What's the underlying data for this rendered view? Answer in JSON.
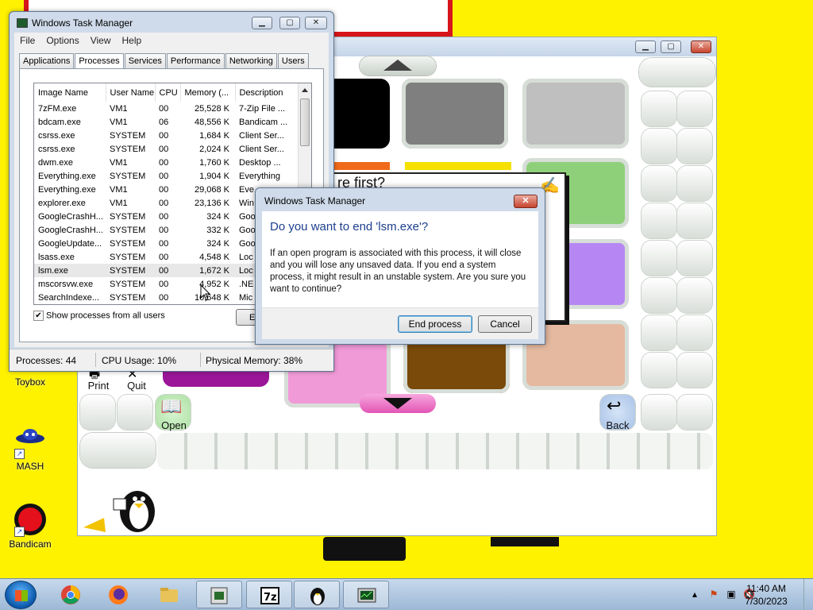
{
  "desktop": {
    "icons": [
      {
        "label": "Toybox",
        "icon": "toybox-icon"
      },
      {
        "label": "MASH",
        "icon": "mash-icon"
      },
      {
        "label": "Bandicam",
        "icon": "bandicam-icon"
      }
    ]
  },
  "tuxpaint": {
    "tools": {
      "print": "Print",
      "quit": "Quit",
      "open": "Open",
      "back": "Back"
    },
    "question_text": "re first?",
    "swatch_colors": [
      "#000000",
      "#7f7f7f",
      "#bfbfbf",
      "#8ed07a",
      "#b687f2",
      "#9a1597",
      "#f19ad8",
      "#7a4a0a",
      "#e5b9a0",
      "#f06a1b",
      "#f6e000"
    ]
  },
  "task_manager": {
    "title": "Windows Task Manager",
    "menu": [
      "File",
      "Options",
      "View",
      "Help"
    ],
    "tabs": [
      "Applications",
      "Processes",
      "Services",
      "Performance",
      "Networking",
      "Users"
    ],
    "active_tab": "Processes",
    "columns": [
      "Image Name",
      "User Name",
      "CPU",
      "Memory (...",
      "Description"
    ],
    "processes": [
      {
        "image": "7zFM.exe",
        "user": "VM1",
        "cpu": "00",
        "memory": "25,528 K",
        "desc": "7-Zip File ..."
      },
      {
        "image": "bdcam.exe",
        "user": "VM1",
        "cpu": "06",
        "memory": "48,556 K",
        "desc": "Bandicam ..."
      },
      {
        "image": "csrss.exe",
        "user": "SYSTEM",
        "cpu": "00",
        "memory": "1,684 K",
        "desc": "Client Ser..."
      },
      {
        "image": "csrss.exe",
        "user": "SYSTEM",
        "cpu": "00",
        "memory": "2,024 K",
        "desc": "Client Ser..."
      },
      {
        "image": "dwm.exe",
        "user": "VM1",
        "cpu": "00",
        "memory": "1,760 K",
        "desc": "Desktop ..."
      },
      {
        "image": "Everything.exe",
        "user": "SYSTEM",
        "cpu": "00",
        "memory": "1,904 K",
        "desc": "Everything"
      },
      {
        "image": "Everything.exe",
        "user": "VM1",
        "cpu": "00",
        "memory": "29,068 K",
        "desc": "Eve"
      },
      {
        "image": "explorer.exe",
        "user": "VM1",
        "cpu": "00",
        "memory": "23,136 K",
        "desc": "Win"
      },
      {
        "image": "GoogleCrashH...",
        "user": "SYSTEM",
        "cpu": "00",
        "memory": "324 K",
        "desc": "Goo"
      },
      {
        "image": "GoogleCrashH...",
        "user": "SYSTEM",
        "cpu": "00",
        "memory": "332 K",
        "desc": "Goo"
      },
      {
        "image": "GoogleUpdate...",
        "user": "SYSTEM",
        "cpu": "00",
        "memory": "324 K",
        "desc": "Goo"
      },
      {
        "image": "lsass.exe",
        "user": "SYSTEM",
        "cpu": "00",
        "memory": "4,548 K",
        "desc": "Loc"
      },
      {
        "image": "lsm.exe",
        "user": "SYSTEM",
        "cpu": "00",
        "memory": "1,672 K",
        "desc": "Loc"
      },
      {
        "image": "mscorsvw.exe",
        "user": "SYSTEM",
        "cpu": "00",
        "memory": "4,952 K",
        "desc": ".NE"
      },
      {
        "image": "SearchIndexe...",
        "user": "SYSTEM",
        "cpu": "00",
        "memory": "10,648 K",
        "desc": "Mic"
      }
    ],
    "selected_index": 12,
    "show_all_label": "Show processes from all users",
    "show_all_checked": true,
    "end_process_label": "End Process",
    "status": {
      "processes": "Processes: 44",
      "cpu": "CPU Usage: 10%",
      "memory": "Physical Memory: 38%"
    }
  },
  "dialog": {
    "title": "Windows Task Manager",
    "instruction": "Do you want to end 'lsm.exe'?",
    "content": "If an open program is associated with this process, it will close and you will lose any unsaved data. If you end a system process, it might result in an unstable system. Are you sure you want to continue?",
    "confirm_label": "End process",
    "cancel_label": "Cancel"
  },
  "taskbar": {
    "items": [
      "start-orb",
      "chrome-icon",
      "firefox-icon",
      "explorer-icon",
      "tuxpaint-launcher-icon",
      "7zip-icon",
      "tuxpaint-icon",
      "task-manager-icon"
    ],
    "time": "11:40 AM",
    "date": "7/30/2023"
  }
}
